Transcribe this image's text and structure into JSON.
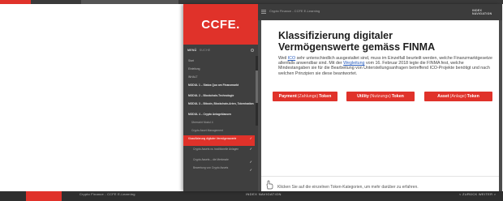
{
  "background": {
    "course_title": "Crypto Finance - CCFE E-Learning",
    "index_label": "INDEX NAVIGATION",
    "prev_next": "< ZURÜCK    WEITER >"
  },
  "window": {
    "logo": "CCFE.",
    "course_title": "Crypto Finance - CCFE E-Learning",
    "index_label": "INDEX NAVIGATION"
  },
  "sidebar": {
    "menu_label": "MENÜ",
    "search_label": "SUCHE",
    "items": [
      {
        "label": "Start",
        "kind": "normal"
      },
      {
        "label": "Einleitung",
        "kind": "normal"
      },
      {
        "label": "INHALT",
        "kind": "normal"
      },
      {
        "label": "MODUL 1 – Status Quo am Finanzmarkt",
        "kind": "module"
      },
      {
        "label": "MODUL 2 – Blockchain-Technologie",
        "kind": "module"
      },
      {
        "label": "MODUL 3 – Bitcoin, Blockchain-Arten, Tokenisation",
        "kind": "module"
      },
      {
        "label": "MODUL 4 – Crypto Anlageklassen",
        "kind": "module"
      },
      {
        "label": "Übersicht Modul 4",
        "kind": "sub"
      },
      {
        "label": "Crypto Asset Management",
        "kind": "sub"
      },
      {
        "label": "Klassifizierung digitaler Vermögenswerte",
        "kind": "active"
      },
      {
        "label": "Crypto Assets vs. traditionelle Anlagen",
        "kind": "sub2"
      },
      {
        "label": "Crypto Assets – die Merkmale",
        "kind": "sub2"
      },
      {
        "label": "Bewertung von Crypto Assets",
        "kind": "sub2"
      }
    ]
  },
  "content": {
    "heading_line1": "Klassifizierung digitaler",
    "heading_line2": "Vermögenswerte gemäss FINMA",
    "para_part1": "Weil ",
    "para_link1": "ICO",
    "para_part2": " sehr unterschiedlich ausgestaltet sind, muss im Einzelfall beurteilt werden, welche Finanzmarktgesetze allenfalls anwendbar sind. Mit der ",
    "para_link2": "Wegleitung",
    "para_part3": " vom 16. Februar 2018 legte die FINMA fest, welche Mindestangaben sie für die Bearbeitung von Unterstellungsanfragen betreffend ICO-Projekte benötigt und nach welchen Prinzipien sie diese beantwortet.",
    "buttons": [
      {
        "main": "Payment",
        "paren": "(Zahlungs)",
        "suffix": "Token"
      },
      {
        "main": "Utility",
        "paren": "(Nutzungs)",
        "suffix": "Token"
      },
      {
        "main": "Asset",
        "paren": "(Anlage)",
        "suffix": "Token"
      }
    ],
    "hint": "Klicken Sie auf die einzelnen Token-Kategorien, um mehr darüber zu erfahren."
  },
  "colors": {
    "accent": "#e0322a",
    "sidebar": "#3f3f3f",
    "header": "#3c3c3c"
  }
}
